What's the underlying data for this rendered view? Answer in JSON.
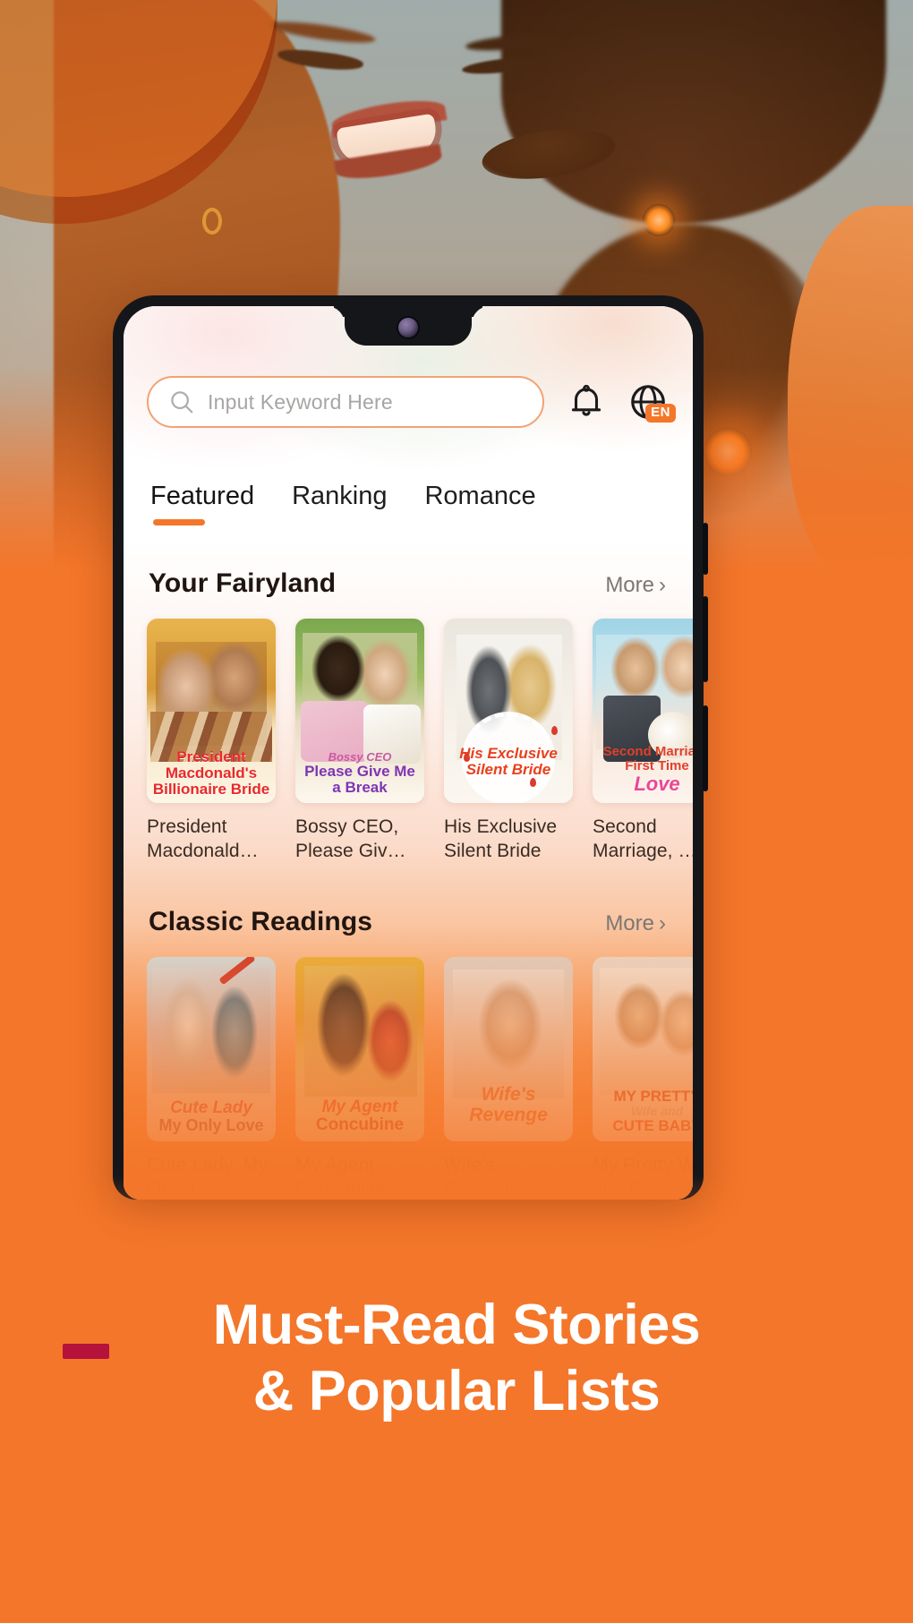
{
  "app": {
    "search": {
      "placeholder": "Input Keyword Here",
      "icon": "search-icon"
    },
    "icons": {
      "bell": "bell-icon",
      "globe": "globe-icon"
    },
    "language_badge": "EN",
    "tabs": [
      {
        "label": "Featured",
        "active": true
      },
      {
        "label": "Ranking",
        "active": false
      },
      {
        "label": "Romance",
        "active": false
      }
    ],
    "sections": [
      {
        "title": "Your Fairyland",
        "more_label": "More",
        "more_chevron": "›",
        "books": [
          {
            "list_title": "President Macdonald…",
            "cover_title_lines": [
              "President",
              "Macdonald's",
              "Billionaire Bride"
            ]
          },
          {
            "list_title": "Bossy CEO, Please Giv…",
            "cover_title_lines": [
              "Bossy CEO",
              "Please Give Me",
              "a Break"
            ]
          },
          {
            "list_title": "His Exclusive Silent Bride",
            "cover_title_lines": [
              "His Exclusive",
              "Silent Bride"
            ]
          },
          {
            "list_title": "Second Marriage, …",
            "cover_title_lines": [
              "Second Marriage",
              "First Time",
              "Love"
            ]
          }
        ]
      },
      {
        "title": "Classic Readings",
        "more_label": "More",
        "more_chevron": "›",
        "books": [
          {
            "list_title": "Cute Lady, My Only L…",
            "cover_title_lines": [
              "Cute Lady",
              "My Only Love"
            ]
          },
          {
            "list_title": "My Agent Concubine",
            "cover_title_lines": [
              "My Agent",
              "Concubine"
            ]
          },
          {
            "list_title": "Wife's Revenge",
            "cover_title_lines": [
              "Wife's",
              "Revenge"
            ]
          },
          {
            "list_title": "My Pretty Wife and C…",
            "cover_title_lines": [
              "MY PRETTY",
              "Wife and",
              "CUTE BABY"
            ]
          }
        ]
      }
    ]
  },
  "promo": {
    "headline_line1": "Must-Read Stories",
    "headline_line2": "& Popular Lists",
    "accent_color": "#B5123C",
    "background_color": "#F4762A"
  }
}
